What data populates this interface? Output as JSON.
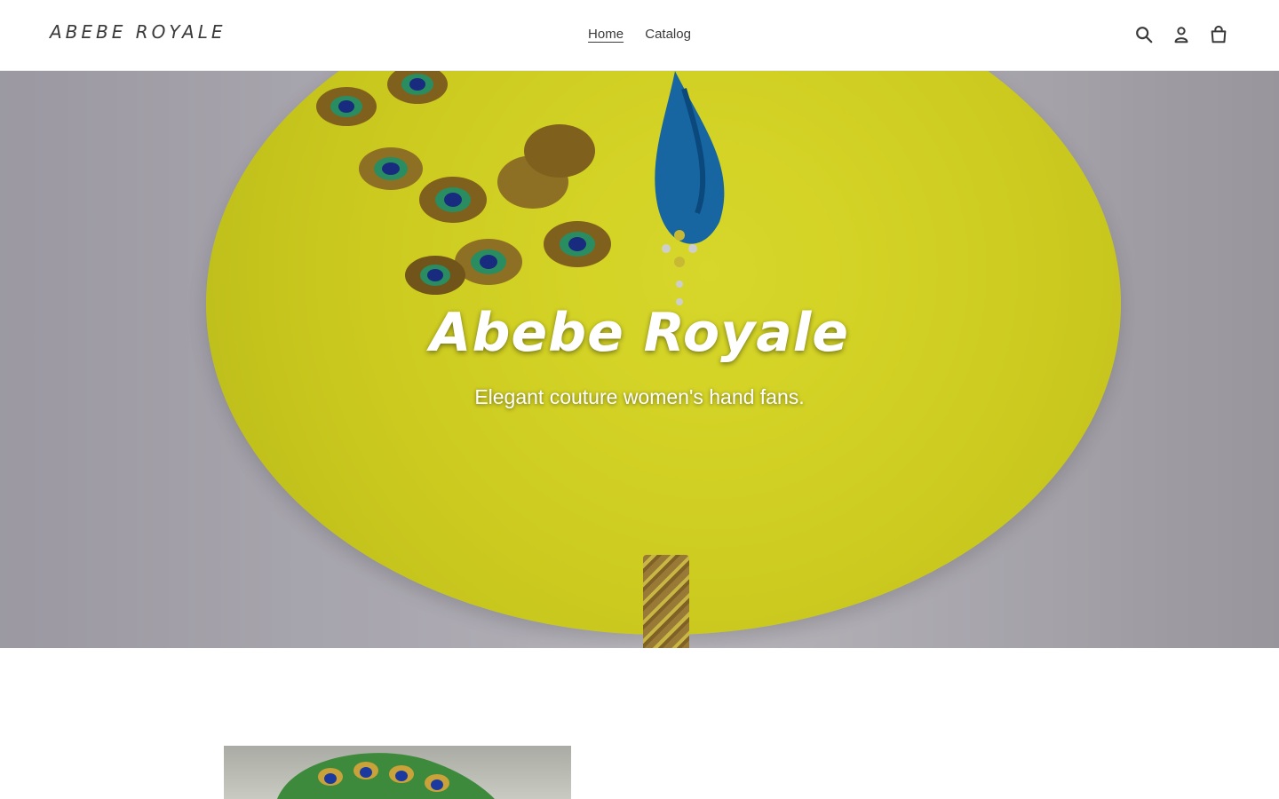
{
  "header": {
    "logo_text": "ABEBE ROYALE",
    "nav": [
      {
        "label": "Home",
        "active": true
      },
      {
        "label": "Catalog",
        "active": false
      }
    ],
    "icons": [
      "search-icon",
      "account-icon",
      "cart-icon"
    ]
  },
  "hero": {
    "title": "Abebe Royale",
    "subtitle": "Elegant couture women's hand fans.",
    "fan_color": "#dedc22"
  },
  "colors": {
    "text": "#3a3a3a",
    "header_bg": "#ffffff"
  }
}
